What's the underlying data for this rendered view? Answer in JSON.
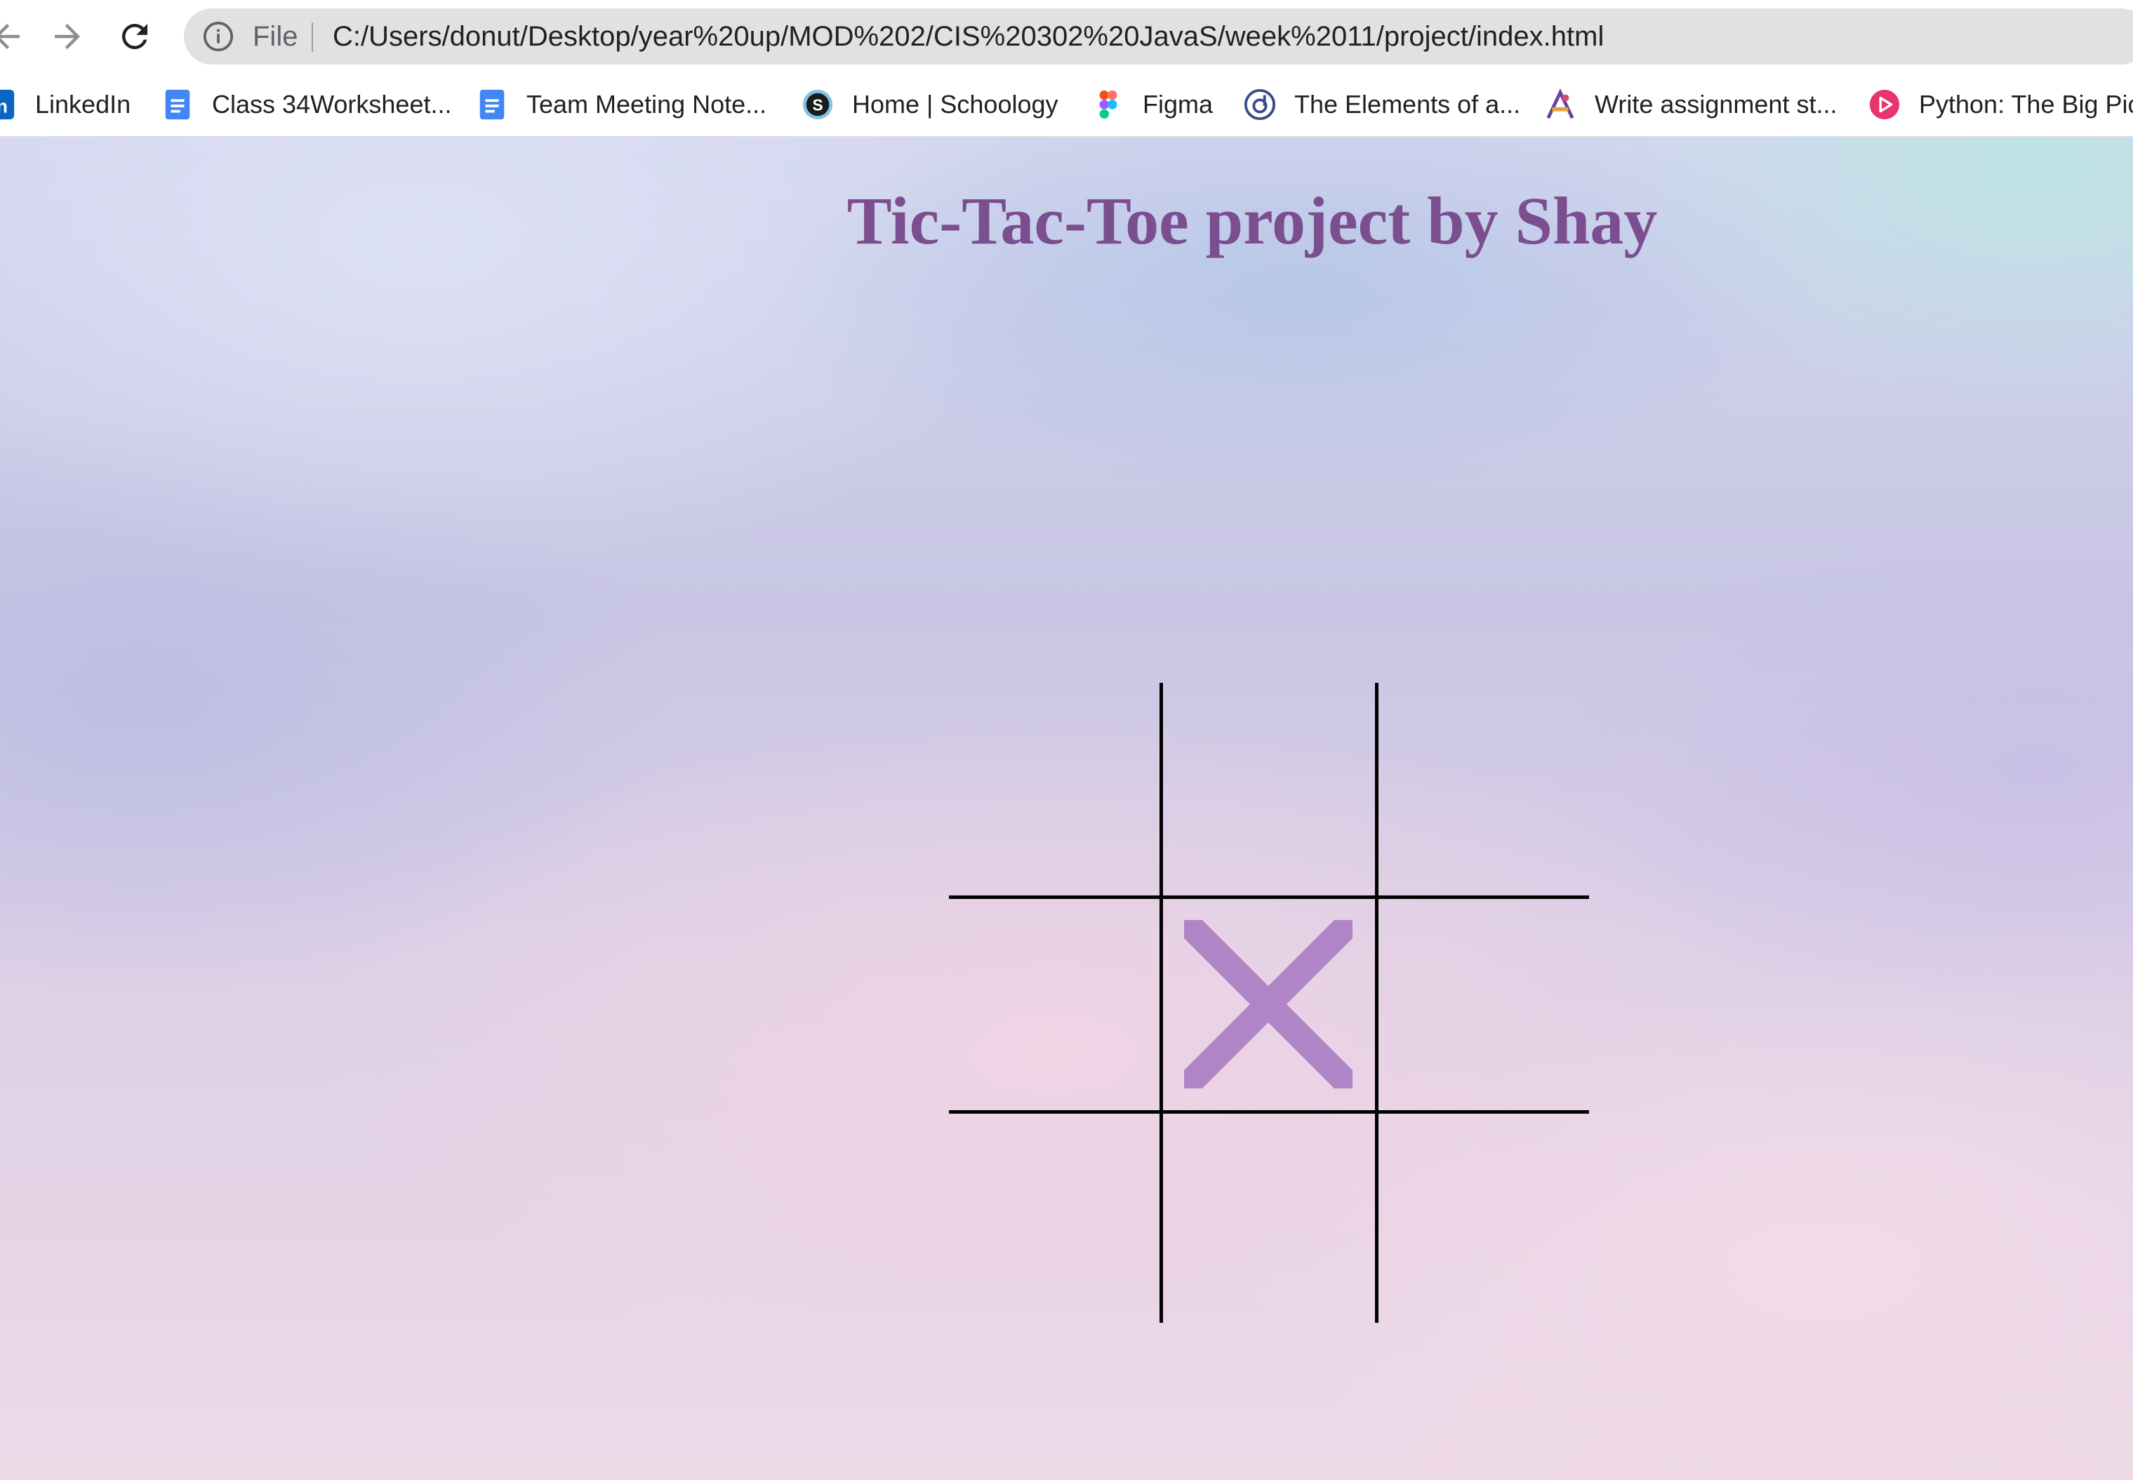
{
  "browser": {
    "omnibox": {
      "scheme_label": "File",
      "url": "C:/Users/donut/Desktop/year%20up/MOD%202/CIS%20302%20JavaS/week%2011/project/index.html"
    },
    "bookmarks": [
      {
        "label": "LinkedIn",
        "icon": "linkedin-icon"
      },
      {
        "label": "Class 34Worksheet...",
        "icon": "google-docs-icon"
      },
      {
        "label": "Team Meeting Note...",
        "icon": "google-docs-icon"
      },
      {
        "label": "Home | Schoology",
        "icon": "schoology-icon"
      },
      {
        "label": "Figma",
        "icon": "figma-icon"
      },
      {
        "label": "The Elements of a...",
        "icon": "site-favicon-icon"
      },
      {
        "label": "Write assignment st...",
        "icon": "site-favicon-icon"
      },
      {
        "label": "Python: The Big Pic",
        "icon": "play-favicon-icon"
      }
    ]
  },
  "page": {
    "title": "Tic-Tac-Toe project by Shay",
    "board": {
      "cells": [
        "",
        "",
        "",
        "",
        "X",
        "",
        "",
        "",
        ""
      ],
      "mark_color": "#b085c7",
      "line_color": "#000000"
    }
  },
  "colors": {
    "title": "#7b4e8f",
    "omnibox_bg": "#e1e1e1"
  }
}
